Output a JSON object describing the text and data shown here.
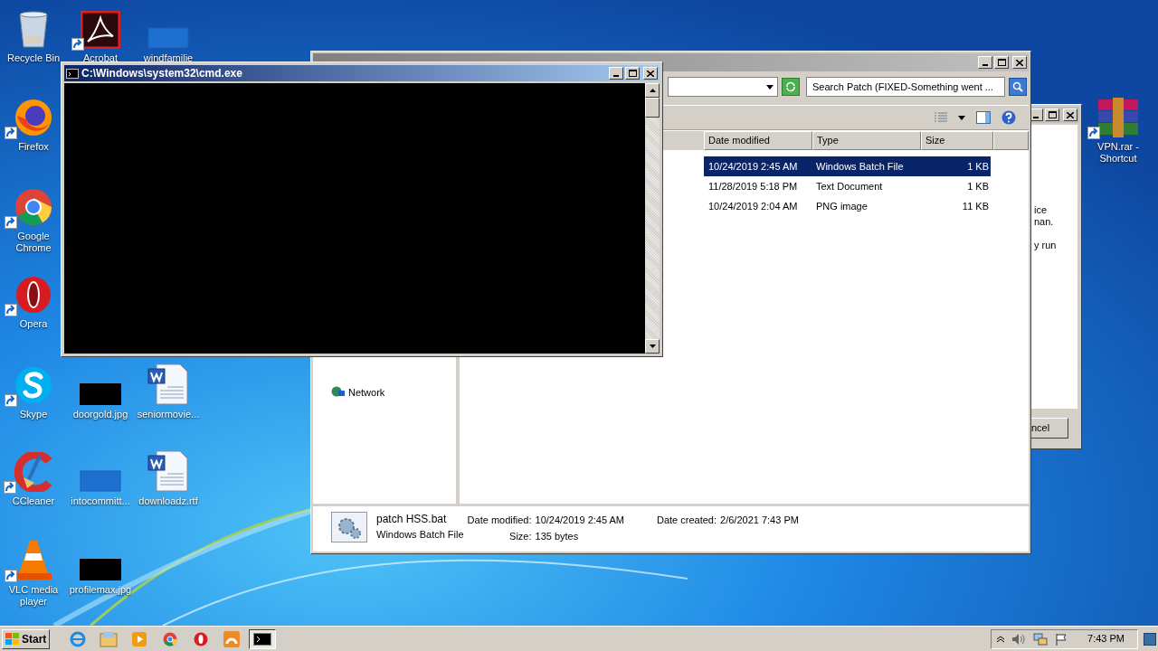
{
  "desktop_icons": [
    {
      "label": "Recycle Bin",
      "kind": "recycle",
      "shortcut": false
    },
    {
      "label": "Acrobat",
      "kind": "acrobat",
      "shortcut": true
    },
    {
      "label": "windfamilie",
      "kind": "blank",
      "shortcut": false
    },
    {
      "label": "Firefox",
      "kind": "firefox",
      "shortcut": true
    },
    {
      "label": "Google Chrome",
      "kind": "chrome",
      "shortcut": true
    },
    {
      "label": "Opera",
      "kind": "opera",
      "shortcut": true
    },
    {
      "label": "Skype",
      "kind": "skype",
      "shortcut": true
    },
    {
      "label": "doorgold.jpg",
      "kind": "image",
      "shortcut": false
    },
    {
      "label": "seniormovie...",
      "kind": "word",
      "shortcut": false
    },
    {
      "label": "CCleaner",
      "kind": "ccleaner",
      "shortcut": true
    },
    {
      "label": "intocommitt...",
      "kind": "blank",
      "shortcut": false
    },
    {
      "label": "downloadz.rtf",
      "kind": "word",
      "shortcut": false
    },
    {
      "label": "VLC media player",
      "kind": "vlc",
      "shortcut": true
    },
    {
      "label": "profilemax.jpg",
      "kind": "image",
      "shortcut": false
    },
    {
      "label": "VPN.rar - Shortcut",
      "kind": "winrar",
      "shortcut": true
    }
  ],
  "cmd": {
    "title": "C:\\Windows\\system32\\cmd.exe"
  },
  "explorer": {
    "search": {
      "placeholder": "Search Patch (FIXED-Something went ..."
    },
    "columns": [
      "Date modified",
      "Type",
      "Size"
    ],
    "rows": [
      {
        "date": "10/24/2019 2:45 AM",
        "type": "Windows Batch File",
        "size": "1 KB",
        "selected": true
      },
      {
        "date": "11/28/2019 5:18 PM",
        "type": "Text Document",
        "size": "1 KB",
        "selected": false
      },
      {
        "date": "10/24/2019 2:04 AM",
        "type": "PNG image",
        "size": "11 KB",
        "selected": false
      }
    ],
    "nav_items": [
      "Network"
    ],
    "details": {
      "name": "patch HSS.bat",
      "type": "Windows Batch File",
      "fields": [
        {
          "label": "Date modified:",
          "value": "10/24/2019 2:45 AM"
        },
        {
          "label": "Size:",
          "value": "135 bytes"
        },
        {
          "label": "Date created:",
          "value": "2/6/2021 7:43 PM"
        }
      ]
    }
  },
  "background_dialog": {
    "text_lines": [
      "ice",
      "nan.",
      "y run"
    ],
    "button": "ncel"
  },
  "taskbar": {
    "start": "Start",
    "items": [
      {
        "kind": "ie",
        "active": false
      },
      {
        "kind": "explorer",
        "active": false
      },
      {
        "kind": "media",
        "active": false
      },
      {
        "kind": "chrome",
        "active": false
      },
      {
        "kind": "opera",
        "active": false
      },
      {
        "kind": "orange",
        "active": false
      },
      {
        "kind": "cmd",
        "active": true
      }
    ],
    "clock": "7:43 PM"
  }
}
